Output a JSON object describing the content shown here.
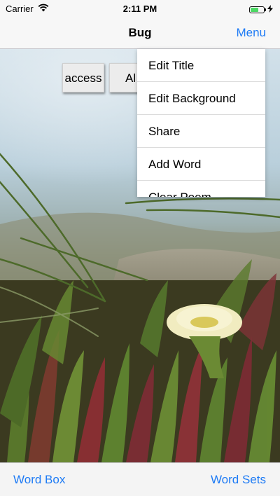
{
  "status_bar": {
    "carrier": "Carrier",
    "time": "2:11 PM",
    "battery_level": 0.6,
    "icons": [
      "wifi-icon",
      "battery-icon",
      "charging-bolt-icon"
    ]
  },
  "nav": {
    "title": "Bug",
    "menu_label": "Menu"
  },
  "tiles": [
    {
      "text": "access"
    },
    {
      "text": "Al"
    }
  ],
  "menu": {
    "items": [
      {
        "label": "Edit Title"
      },
      {
        "label": "Edit Background"
      },
      {
        "label": "Share"
      },
      {
        "label": "Add Word"
      },
      {
        "label": "Clear Poem"
      }
    ]
  },
  "toolbar": {
    "left_label": "Word Box",
    "right_label": "Word Sets"
  },
  "colors": {
    "accent": "#1e7bf5",
    "battery_fill": "#4cd964",
    "bar_background": "#f7f7f7"
  }
}
